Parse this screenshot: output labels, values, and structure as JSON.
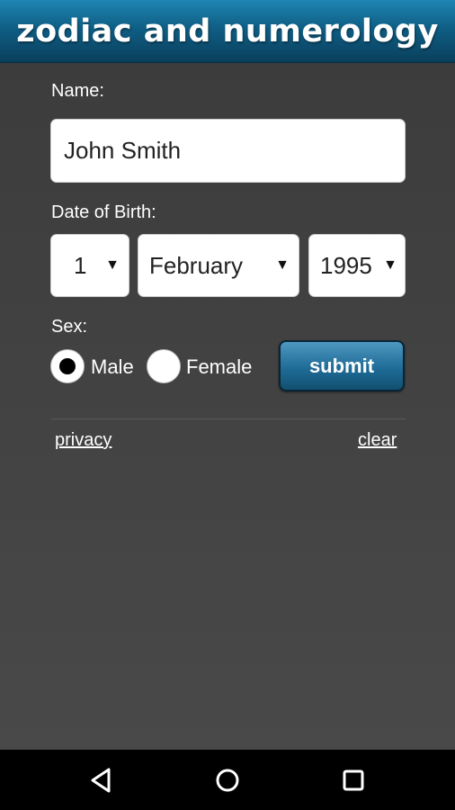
{
  "header": {
    "title": "zodiac and numerology"
  },
  "form": {
    "name_label": "Name:",
    "name_value": "John Smith",
    "dob_label": "Date of Birth:",
    "day": "1",
    "month": "February",
    "year": "1995",
    "sex_label": "Sex:",
    "male_label": "Male",
    "female_label": "Female",
    "selected_sex": "Male",
    "submit_label": "submit"
  },
  "links": {
    "privacy": "privacy",
    "clear": "clear"
  },
  "icons": {
    "dropdown": "chevron-down-icon",
    "nav_back": "back-icon",
    "nav_home": "home-icon",
    "nav_recent": "recent-apps-icon"
  },
  "colors": {
    "header": "#0f5e85",
    "button": "#1f6c98",
    "background": "#444444"
  }
}
